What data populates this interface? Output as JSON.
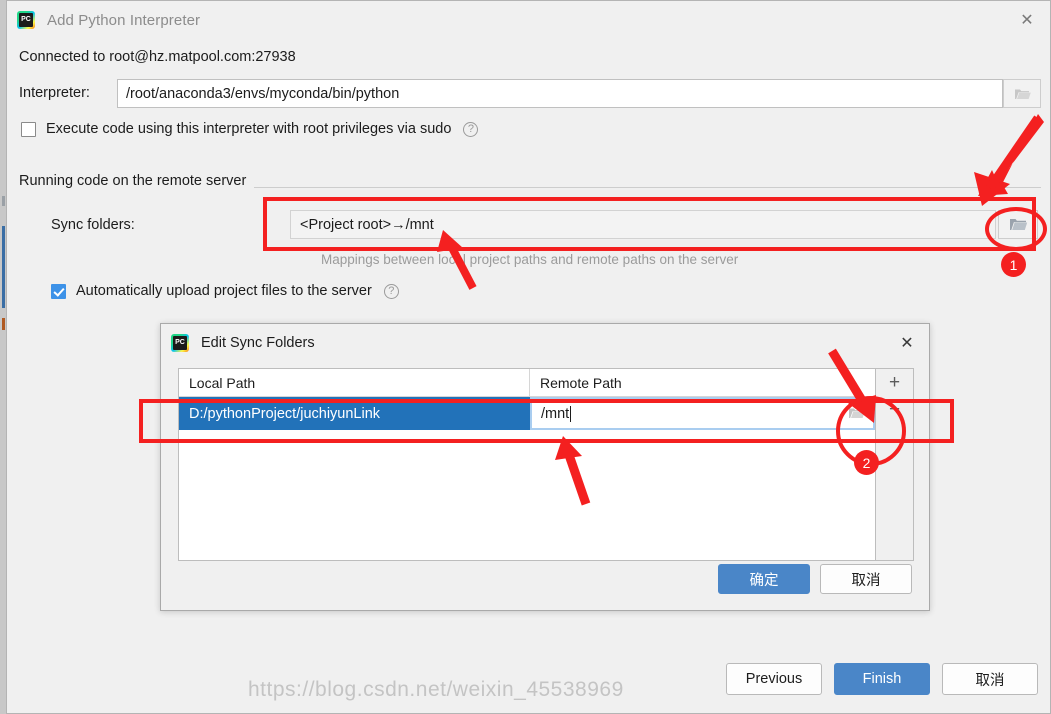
{
  "window": {
    "title": "Add Python Interpreter",
    "app_icon": "pycharm-icon",
    "close_icon": "✕"
  },
  "main": {
    "connected_text": "Connected to root@hz.matpool.com:27938",
    "interpreter_label": "Interpreter:",
    "interpreter_value": "/root/anaconda3/envs/myconda/bin/python",
    "interpreter_browse_icon": "folder-icon",
    "sudo_checkbox": {
      "label": "Execute code using this interpreter with root privileges via sudo",
      "checked": false,
      "help_icon": "?"
    },
    "group_title": "Running code on the remote server",
    "sync_label": "Sync folders:",
    "sync_value": "<Project root>→/mnt",
    "sync_browse_icon": "folder-icon",
    "sync_hint": "Mappings between local project paths and remote paths on the server",
    "autoupload_checkbox": {
      "label": "Automatically upload project files to the server",
      "checked": true,
      "help_icon": "?"
    }
  },
  "footer": {
    "previous_label": "Previous",
    "finish_label": "Finish",
    "cancel_label": "取消"
  },
  "edit_dialog": {
    "title": "Edit Sync Folders",
    "app_icon": "pycharm-icon",
    "close_icon": "✕",
    "columns": [
      "Local Path",
      "Remote Path"
    ],
    "rows": [
      {
        "local_path": "D:/pythonProject/juchiyunLink",
        "remote_path": "/mnt",
        "browse_icon": "folder-icon",
        "selected": true,
        "editing": true
      }
    ],
    "add_button_label": "+",
    "remove_button_label": "−",
    "ok_label": "确定",
    "cancel_label": "取消"
  },
  "annotations": {
    "badge_1": "1",
    "badge_2": "2",
    "accent_color": "#f42020"
  },
  "watermark": {
    "text": "https://blog.csdn.net/weixin_45538969"
  }
}
